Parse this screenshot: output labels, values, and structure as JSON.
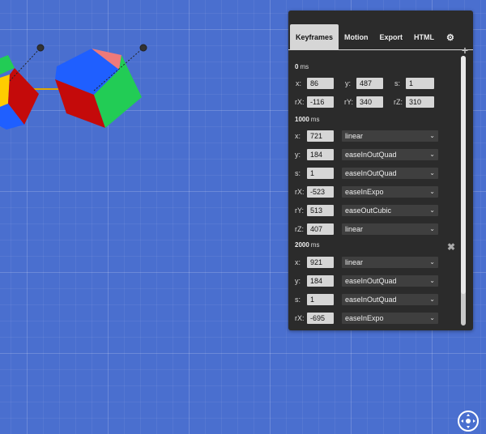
{
  "colors": {
    "background": "#4a6fcf",
    "panel": "#2b2b2b",
    "cube_red": "#c40a0a",
    "cube_green": "#22cc55",
    "cube_blue": "#1f5fff",
    "cube_pink": "#ee7a7a",
    "cube_yellow": "#ffcc00",
    "path_line": "#e0a800"
  },
  "tabs": [
    {
      "label": "Keyframes",
      "active": true
    },
    {
      "label": "Motion"
    },
    {
      "label": "Export"
    },
    {
      "label": "HTML"
    },
    {
      "label": "",
      "icon": "gear-icon"
    }
  ],
  "keyframes": [
    {
      "time": "0",
      "unit": "ms",
      "x": "86",
      "y": "487",
      "s": "1",
      "rX": "-116",
      "rY": "340",
      "rZ": "310"
    },
    {
      "time": "1000",
      "unit": "ms",
      "rows": [
        {
          "label": "x:",
          "value": "721",
          "easing": "linear"
        },
        {
          "label": "y:",
          "value": "184",
          "easing": "easeInOutQuad"
        },
        {
          "label": "s:",
          "value": "1",
          "easing": "easeInOutQuad"
        },
        {
          "label": "rX:",
          "value": "-523",
          "easing": "easeInExpo"
        },
        {
          "label": "rY:",
          "value": "513",
          "easing": "easeOutCubic"
        },
        {
          "label": "rZ:",
          "value": "407",
          "easing": "linear"
        }
      ]
    },
    {
      "time": "2000",
      "unit": "ms",
      "rows": [
        {
          "label": "x:",
          "value": "921",
          "easing": "linear"
        },
        {
          "label": "y:",
          "value": "184",
          "easing": "easeInOutQuad"
        },
        {
          "label": "s:",
          "value": "1",
          "easing": "easeInOutQuad"
        },
        {
          "label": "rX:",
          "value": "-695",
          "easing": "easeInExpo"
        }
      ]
    }
  ],
  "labels": {
    "x": "x:",
    "y": "y:",
    "s": "s:",
    "rX": "rX:",
    "rY": "rY:",
    "rZ": "rZ:",
    "add": "+",
    "remove": "✖"
  }
}
